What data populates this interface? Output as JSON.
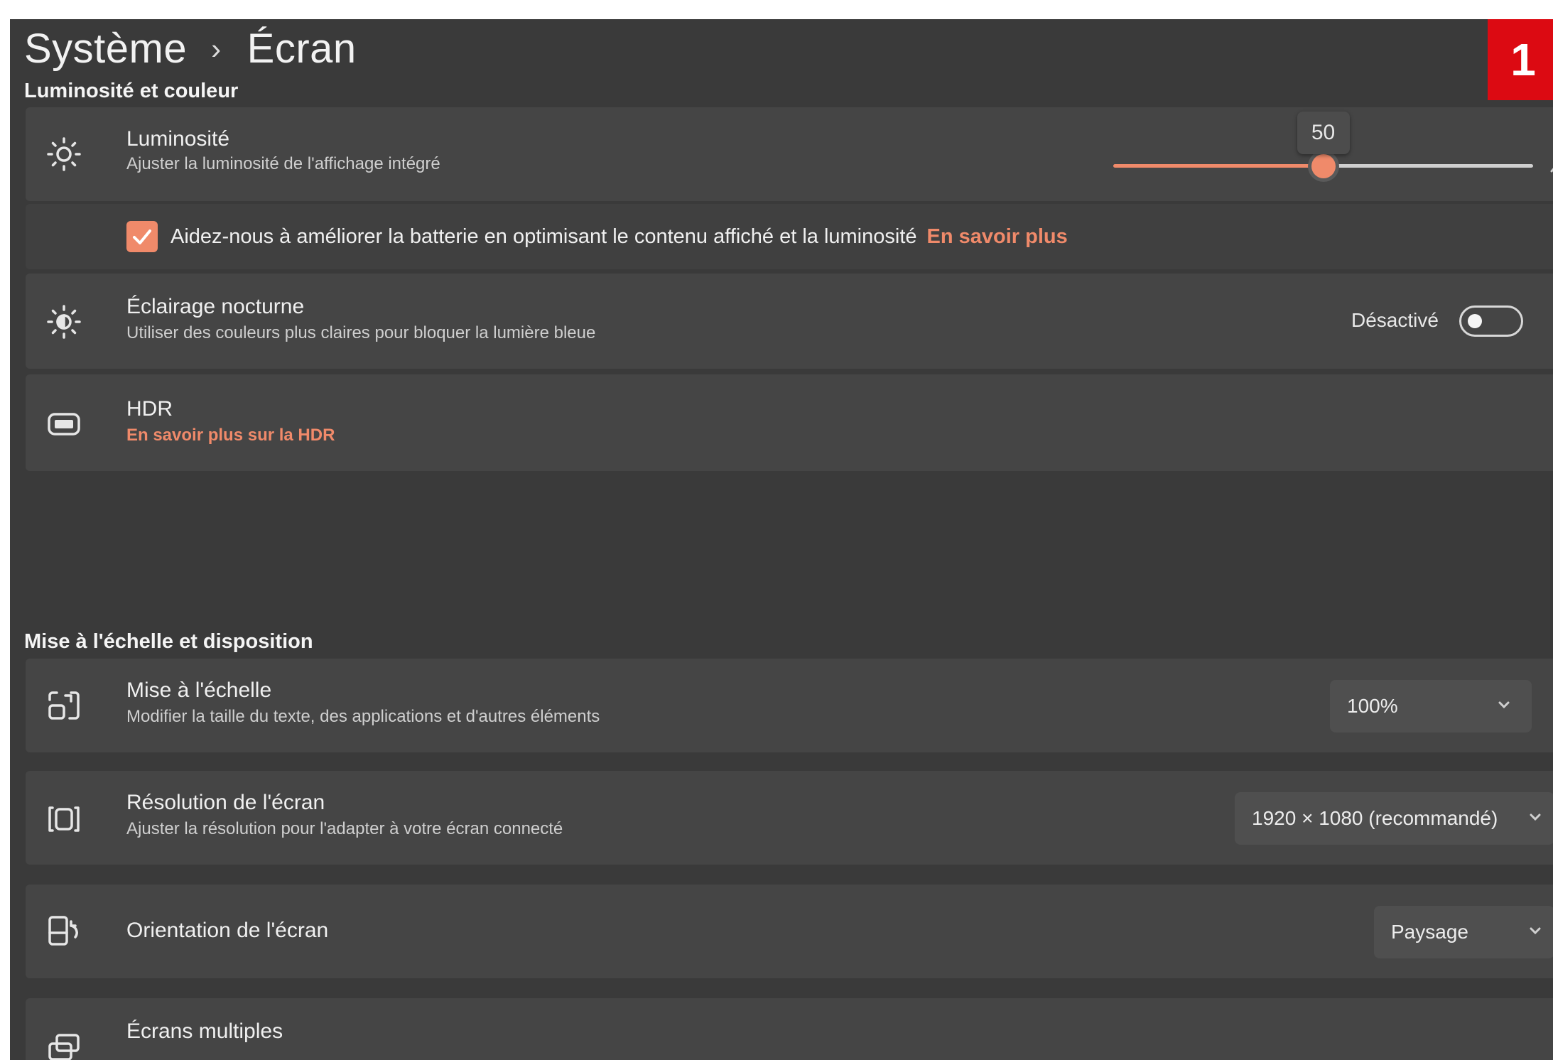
{
  "breadcrumb": {
    "parent": "Système",
    "separator": "›",
    "current": "Écran"
  },
  "badge": "1",
  "sections": {
    "brightness_color": "Luminosité et couleur",
    "scale_layout": "Mise à l'échelle et disposition"
  },
  "brightness": {
    "icon": "sun-icon",
    "title": "Luminosité",
    "desc": "Ajuster la luminosité de l'affichage intégré",
    "value": 50,
    "tooltip": "50"
  },
  "battery_option": {
    "checked": true,
    "label": "Aidez-nous à améliorer la batterie en optimisant le contenu affiché et la luminosité",
    "link": "En savoir plus"
  },
  "night_light": {
    "icon": "night-light-icon",
    "title": "Éclairage nocturne",
    "desc": "Utiliser des couleurs plus claires pour bloquer la lumière bleue",
    "state_label": "Désactivé",
    "on": false
  },
  "hdr": {
    "icon": "hdr-icon",
    "title": "HDR",
    "link": "En savoir plus sur la HDR"
  },
  "scale": {
    "icon": "scale-icon",
    "title": "Mise à l'échelle",
    "desc": "Modifier la taille du texte, des applications et d'autres éléments",
    "value": "100%"
  },
  "resolution": {
    "icon": "resolution-icon",
    "title": "Résolution de l'écran",
    "desc": "Ajuster la résolution pour l'adapter à  votre  écran connecté",
    "value": "1920 × 1080 (recommandé)"
  },
  "orientation": {
    "icon": "orientation-icon",
    "title": "Orientation de l'écran",
    "value": "Paysage"
  },
  "multiple_displays": {
    "icon": "multiple-displays-icon",
    "title": "Écrans multiples"
  },
  "colors": {
    "accent": "#f08a6a",
    "background": "#3a3a3a",
    "card": "#454545",
    "badge": "#dc0a12"
  }
}
